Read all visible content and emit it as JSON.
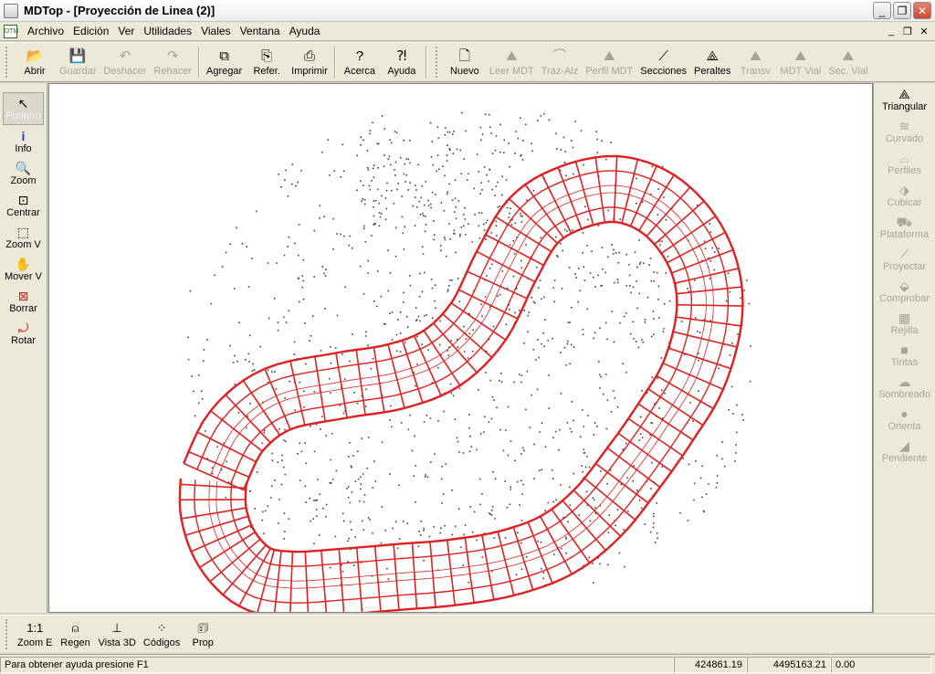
{
  "window": {
    "title": "MDTop - [Proyección de Linea (2)]",
    "buttons": {
      "minimize": "_",
      "maximize": "❐",
      "close": "✕"
    }
  },
  "menubar": {
    "doc_icon_text": "DTM",
    "items": [
      "Archivo",
      "Edición",
      "Ver",
      "Utilidades",
      "Viales",
      "Ventana",
      "Ayuda"
    ],
    "doc_buttons": {
      "minimize": "_",
      "restore": "❐",
      "close": "✕"
    }
  },
  "toolbar": {
    "file_group": [
      {
        "label": "Abrir",
        "icon": "open-folder-icon",
        "glyph": "📂",
        "enabled": true
      },
      {
        "label": "Guardar",
        "icon": "save-icon",
        "glyph": "💾",
        "enabled": false
      },
      {
        "label": "Deshacer",
        "icon": "undo-icon",
        "glyph": "↶",
        "enabled": false
      },
      {
        "label": "Rehacer",
        "icon": "redo-icon",
        "glyph": "↷",
        "enabled": false
      }
    ],
    "edit_group": [
      {
        "label": "Agregar",
        "icon": "add-icon",
        "glyph": "⧉",
        "enabled": true
      },
      {
        "label": "Refer.",
        "icon": "reference-icon",
        "glyph": "⎘",
        "enabled": true
      },
      {
        "label": "Imprimir",
        "icon": "printer-icon",
        "glyph": "⎙",
        "enabled": true
      }
    ],
    "help_group": [
      {
        "label": "Acerca",
        "icon": "about-icon",
        "glyph": "?",
        "enabled": true
      },
      {
        "label": "Ayuda",
        "icon": "help-icon",
        "glyph": "⁈",
        "enabled": true
      }
    ],
    "mdt_group": [
      {
        "label": "Nuevo",
        "icon": "new-icon",
        "glyph": "🗋",
        "enabled": true
      },
      {
        "label": "Leer MDT",
        "icon": "read-mdt-icon",
        "glyph": "⛰",
        "enabled": false
      },
      {
        "label": "Traz-Alz",
        "icon": "trace-elevation-icon",
        "glyph": "⌒",
        "enabled": false
      },
      {
        "label": "Perfil MDT",
        "icon": "profile-mdt-icon",
        "glyph": "⛰",
        "enabled": false
      },
      {
        "label": "Secciones",
        "icon": "sections-icon",
        "glyph": "⟋",
        "enabled": true
      },
      {
        "label": "Peraltes",
        "icon": "superelevation-icon",
        "glyph": "⟁",
        "enabled": true
      },
      {
        "label": "Transv",
        "icon": "transverse-icon",
        "glyph": "⛰",
        "enabled": false
      },
      {
        "label": "MDT Vial",
        "icon": "mdt-road-icon",
        "glyph": "⛰",
        "enabled": false
      },
      {
        "label": "Sec. Vial",
        "icon": "road-section-icon",
        "glyph": "⛰",
        "enabled": false
      }
    ]
  },
  "left_tools": [
    {
      "label": "Puntero",
      "icon": "pointer-icon",
      "glyph": "↖",
      "active": true
    },
    {
      "label": "Info",
      "icon": "info-icon",
      "glyph": "i",
      "active": false
    },
    {
      "label": "Zoom",
      "icon": "zoom-icon",
      "glyph": "🔍",
      "active": false
    },
    {
      "label": "Centrar",
      "icon": "center-icon",
      "glyph": "⊡",
      "active": false
    },
    {
      "label": "Zoom V",
      "icon": "zoom-window-icon",
      "glyph": "⬚",
      "active": false
    },
    {
      "label": "Mover V",
      "icon": "pan-hand-icon",
      "glyph": "✋",
      "active": false
    },
    {
      "label": "Borrar",
      "icon": "erase-icon",
      "glyph": "⊠",
      "active": false
    },
    {
      "label": "Rotar",
      "icon": "rotate-icon",
      "glyph": "⤾",
      "active": false
    }
  ],
  "right_tools": [
    {
      "label": "Triangular",
      "icon": "triangulate-icon",
      "glyph": "⟁",
      "enabled": true
    },
    {
      "label": "Curvado",
      "icon": "contour-icon",
      "glyph": "≋",
      "enabled": false
    },
    {
      "label": "Perfiles",
      "icon": "profiles-icon",
      "glyph": "⌓",
      "enabled": false
    },
    {
      "label": "Cubicar",
      "icon": "cube-volume-icon",
      "glyph": "⬗",
      "enabled": false
    },
    {
      "label": "Plataforma",
      "icon": "platform-icon",
      "glyph": "⛟",
      "enabled": false
    },
    {
      "label": "Proyectar",
      "icon": "project-icon",
      "glyph": "⟋",
      "enabled": false
    },
    {
      "label": "Comprobar",
      "icon": "check-icon",
      "glyph": "⬙",
      "enabled": false
    },
    {
      "label": "Rejilla",
      "icon": "grid-icon",
      "glyph": "▦",
      "enabled": false
    },
    {
      "label": "Tintas",
      "icon": "tints-icon",
      "glyph": "■",
      "enabled": false
    },
    {
      "label": "Sombreado",
      "icon": "shading-icon",
      "glyph": "☁",
      "enabled": false
    },
    {
      "label": "Orienta",
      "icon": "orientation-icon",
      "glyph": "●",
      "enabled": false
    },
    {
      "label": "Pendiente",
      "icon": "slope-icon",
      "glyph": "◢",
      "enabled": false
    }
  ],
  "bottom_tools": [
    {
      "label": "Zoom E",
      "icon": "zoom-extents-icon",
      "glyph": "1:1"
    },
    {
      "label": "Regen",
      "icon": "regen-icon",
      "glyph": "⍝"
    },
    {
      "label": "Vista 3D",
      "icon": "view-3d-icon",
      "glyph": "⊥"
    },
    {
      "label": "Códigos",
      "icon": "codes-icon",
      "glyph": "⁘"
    },
    {
      "label": "Prop",
      "icon": "properties-icon",
      "glyph": "🗊"
    }
  ],
  "status": {
    "help": "Para obtener ayuda presione F1",
    "x": "424861.19",
    "y": "4495163.21",
    "z": "0.00"
  },
  "colors": {
    "corridor": "#e02020",
    "points": "#404040"
  }
}
